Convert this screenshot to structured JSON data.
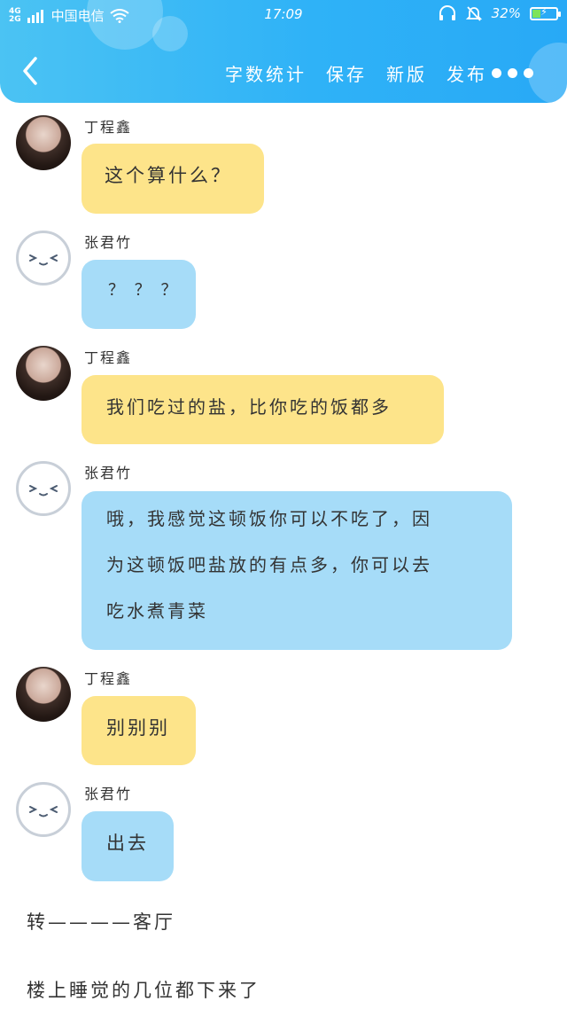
{
  "status_bar": {
    "network_type_top": "4G",
    "network_type_bottom": "2G",
    "carrier": "中国电信",
    "time": "17:09",
    "battery_percent": "32%",
    "battery_level": 0.32
  },
  "toolbar": {
    "actions": [
      "字数统计",
      "保存",
      "新版",
      "发布"
    ]
  },
  "messages": [
    {
      "sender": "丁程鑫",
      "text": "这个算什么？",
      "color": "yellow"
    },
    {
      "sender": "张君竹",
      "text": "？ ？ ？",
      "color": "blue"
    },
    {
      "sender": "丁程鑫",
      "text": "我们吃过的盐，比你吃的饭都多",
      "color": "yellow"
    },
    {
      "sender": "张君竹",
      "lines": [
        "哦，我感觉这顿饭你可以不吃了，因",
        "为这顿饭吧盐放的有点多，你可以去",
        "吃水煮青菜"
      ],
      "color": "blue"
    },
    {
      "sender": "丁程鑫",
      "text": "别别别",
      "color": "yellow"
    },
    {
      "sender": "张君竹",
      "text": "出去",
      "color": "blue"
    }
  ],
  "narration": [
    "转————客厅",
    "楼上睡觉的几位都下来了"
  ],
  "colors": {
    "header_gradient_start": "#4bc3f3",
    "header_gradient_end": "#28a9f6",
    "bubble_yellow": "#fde48a",
    "bubble_blue": "#a6dcf8"
  }
}
